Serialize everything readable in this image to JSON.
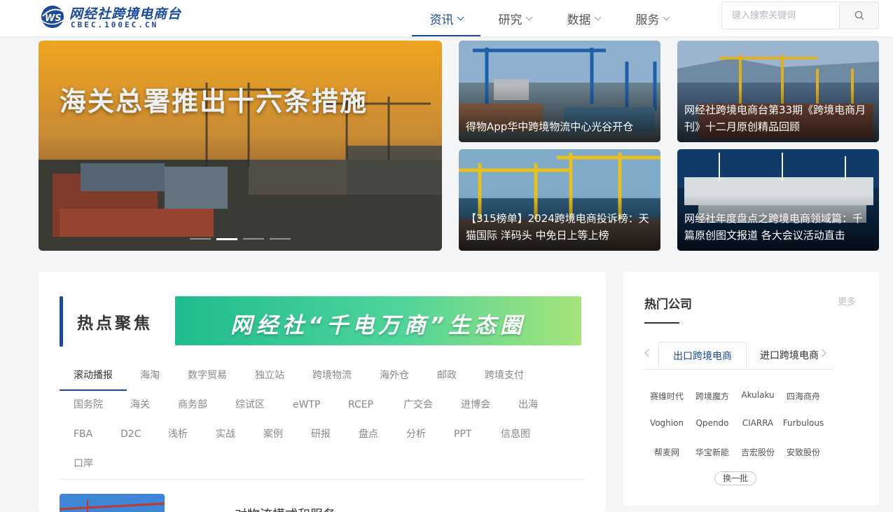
{
  "brand": {
    "name_cn": "网经社跨境电商台",
    "name_en": "CBEC.100EC.CN",
    "logo_mark": "WS",
    "accent": "#1a4a9b"
  },
  "nav": [
    {
      "label": "资讯",
      "active": true
    },
    {
      "label": "研究",
      "active": false
    },
    {
      "label": "数据",
      "active": false
    },
    {
      "label": "服务",
      "active": false
    }
  ],
  "search": {
    "placeholder": "键入搜索关键词",
    "icon": "search-icon"
  },
  "banner": {
    "hero_title": "海关总署推出十六条措施",
    "slide_count": 4,
    "active_slide": 1,
    "cards": [
      {
        "title": "得物App华中跨境物流中心光谷开仓"
      },
      {
        "title": "网经社跨境电商台第33期《跨境电商月刊》十二月原创精品回顾"
      },
      {
        "title": "【315榜单】2024跨境电商投诉榜：天猫国际 洋码头 中免日上等上榜"
      },
      {
        "title": "网经社年度盘点之跨境电商领域篇：千篇原创图文报道 各大会议活动直击"
      }
    ]
  },
  "hot": {
    "label": "热点聚焦",
    "promo_text": "网经社“千电万商”生态圈",
    "tags": [
      "滚动播报",
      "海淘",
      "数字贸易",
      "独立站",
      "跨境物流",
      "海外仓",
      "邮政",
      "跨境支付",
      "国务院",
      "海关",
      "商务部",
      "综试区",
      "eWTP",
      "RCEP",
      "广交会",
      "进博会",
      "出海",
      "FBA",
      "D2C",
      "浅析",
      "实战",
      "案例",
      "研报",
      "盘点",
      "分析",
      "PPT",
      "信息图",
      "口岸"
    ],
    "active_tag": "滚动播报",
    "article_preview": "对物流模式和服务…"
  },
  "companies": {
    "title": "热门公司",
    "more": "更多",
    "tabs": [
      {
        "label": "出口跨境电商",
        "active": true
      },
      {
        "label": "进口跨境电商",
        "active": false
      }
    ],
    "list": [
      "赛维时代",
      "跨境魔方",
      "Akulaku",
      "四海商舟",
      "Voghion",
      "Qpendo",
      "CIARRA",
      "Furbulous",
      "帮麦网",
      "华宝新能",
      "吉宏股份",
      "安致股份"
    ],
    "refresh": "换一批"
  }
}
